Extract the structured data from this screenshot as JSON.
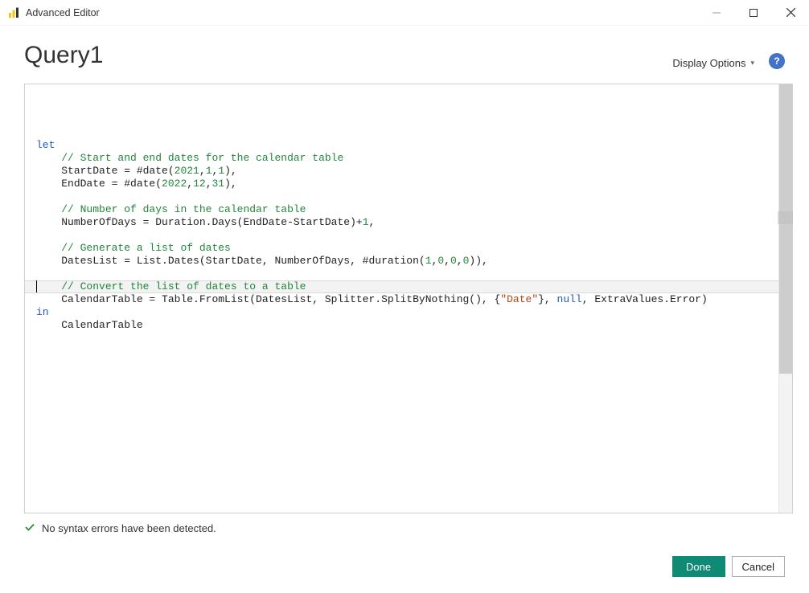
{
  "window": {
    "title": "Advanced Editor"
  },
  "header": {
    "query_name": "Query1",
    "display_options_label": "Display Options"
  },
  "code": {
    "lines": [
      {
        "indent": 0,
        "segments": [
          {
            "t": "let",
            "c": "kw"
          }
        ]
      },
      {
        "indent": 1,
        "segments": [
          {
            "t": "// Start and end dates for the calendar table",
            "c": "cmt"
          }
        ]
      },
      {
        "indent": 1,
        "segments": [
          {
            "t": "StartDate = #date("
          },
          {
            "t": "2021",
            "c": "num"
          },
          {
            "t": ","
          },
          {
            "t": "1",
            "c": "num"
          },
          {
            "t": ","
          },
          {
            "t": "1",
            "c": "num"
          },
          {
            "t": "),"
          }
        ]
      },
      {
        "indent": 1,
        "segments": [
          {
            "t": "EndDate = #date("
          },
          {
            "t": "2022",
            "c": "num"
          },
          {
            "t": ","
          },
          {
            "t": "12",
            "c": "num"
          },
          {
            "t": ","
          },
          {
            "t": "31",
            "c": "num"
          },
          {
            "t": "),"
          }
        ]
      },
      {
        "indent": 1,
        "segments": [
          {
            "t": " "
          }
        ]
      },
      {
        "indent": 1,
        "segments": [
          {
            "t": "// Number of days in the calendar table",
            "c": "cmt"
          }
        ]
      },
      {
        "indent": 1,
        "segments": [
          {
            "t": "NumberOfDays = Duration.Days(EndDate-StartDate)+"
          },
          {
            "t": "1",
            "c": "num"
          },
          {
            "t": ","
          }
        ]
      },
      {
        "indent": 1,
        "segments": [
          {
            "t": " "
          }
        ]
      },
      {
        "indent": 1,
        "segments": [
          {
            "t": "// Generate a list of dates",
            "c": "cmt"
          }
        ]
      },
      {
        "indent": 1,
        "segments": [
          {
            "t": "DatesList = List.Dates(StartDate, NumberOfDays, #duration("
          },
          {
            "t": "1",
            "c": "num"
          },
          {
            "t": ","
          },
          {
            "t": "0",
            "c": "num"
          },
          {
            "t": ","
          },
          {
            "t": "0",
            "c": "num"
          },
          {
            "t": ","
          },
          {
            "t": "0",
            "c": "num"
          },
          {
            "t": ")),"
          }
        ]
      },
      {
        "indent": 1,
        "segments": [
          {
            "t": " "
          }
        ]
      },
      {
        "indent": 1,
        "segments": [
          {
            "t": "// Convert the list of dates to a table",
            "c": "cmt"
          }
        ]
      },
      {
        "indent": 1,
        "segments": [
          {
            "t": "CalendarTable = Table.FromList(DatesList, Splitter.SplitByNothing(), {"
          },
          {
            "t": "\"Date\"",
            "c": "str"
          },
          {
            "t": "}, "
          },
          {
            "t": "null",
            "c": "nul"
          },
          {
            "t": ", ExtraValues.Error)"
          }
        ]
      },
      {
        "indent": 0,
        "segments": [
          {
            "t": "in",
            "c": "kw"
          }
        ]
      },
      {
        "indent": 1,
        "segments": [
          {
            "t": "CalendarTable"
          }
        ]
      }
    ]
  },
  "status": {
    "message": "No syntax errors have been detected."
  },
  "buttons": {
    "done": "Done",
    "cancel": "Cancel"
  }
}
